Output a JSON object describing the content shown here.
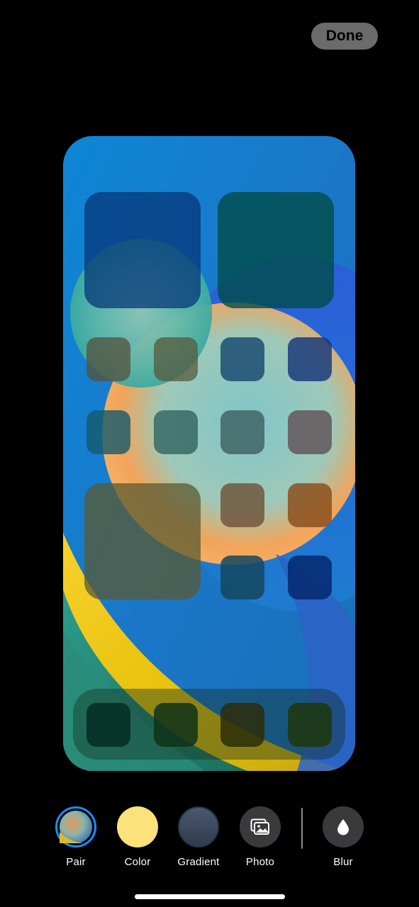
{
  "header": {
    "done_label": "Done"
  },
  "toolbar": {
    "items": [
      {
        "label": "Pair",
        "icon": "pair-wallpaper-icon",
        "selected": true
      },
      {
        "label": "Color",
        "icon": "color-swatch-icon",
        "swatch": "#fbe27a"
      },
      {
        "label": "Gradient",
        "icon": "gradient-swatch-icon",
        "swatch": "#3b4a60"
      },
      {
        "label": "Photo",
        "icon": "photos-icon"
      },
      {
        "label": "Blur",
        "icon": "blur-drop-icon"
      }
    ]
  },
  "colors": {
    "accent": "#1a8cff",
    "done_bg": "#6b6b6b"
  }
}
